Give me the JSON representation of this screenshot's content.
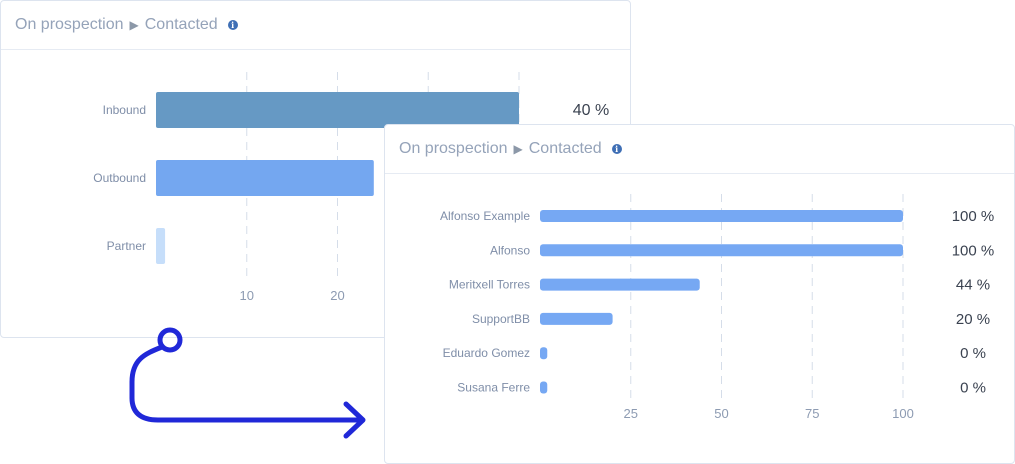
{
  "cards": [
    {
      "header": {
        "stage_from": "On prospection",
        "separator": "▶",
        "stage_to": "Contacted",
        "info_icon": "i"
      },
      "chart_data": {
        "type": "bar",
        "orientation": "horizontal",
        "categories": [
          "Inbound",
          "Outbound",
          "Partner"
        ],
        "values": [
          40,
          24,
          1
        ],
        "value_labels": [
          "40 %",
          "",
          ""
        ],
        "x_ticks": [
          10,
          20,
          30,
          40
        ],
        "x_tick_labels": [
          "10",
          "20",
          "",
          ""
        ],
        "xlim": [
          0,
          40
        ],
        "grid": "vertical dashed",
        "colors": [
          "#6699c4",
          "#74a7f0",
          "#c6defa"
        ]
      }
    },
    {
      "header": {
        "stage_from": "On prospection",
        "separator": "▶",
        "stage_to": "Contacted",
        "info_icon": "i"
      },
      "chart_data": {
        "type": "bar",
        "orientation": "horizontal",
        "categories": [
          "Alfonso Example",
          "Alfonso",
          "Meritxell Torres",
          "SupportBB",
          "Eduardo Gomez",
          "Susana Ferre"
        ],
        "values": [
          100,
          100,
          44,
          20,
          2,
          2
        ],
        "value_labels": [
          "100 %",
          "100 %",
          "44 %",
          "20 %",
          "0 %",
          "0 %"
        ],
        "x_ticks": [
          25,
          50,
          75,
          100
        ],
        "x_tick_labels": [
          "25",
          "50",
          "75",
          "100"
        ],
        "xlim": [
          0,
          100
        ],
        "grid": "vertical dashed",
        "colors": [
          "#76a8f3",
          "#76a8f3",
          "#76a8f3",
          "#76a8f3",
          "#76a8f3",
          "#76a8f3"
        ]
      }
    }
  ],
  "connector": {
    "color": "#2028d8",
    "icon": "curved-arrow-icon"
  }
}
